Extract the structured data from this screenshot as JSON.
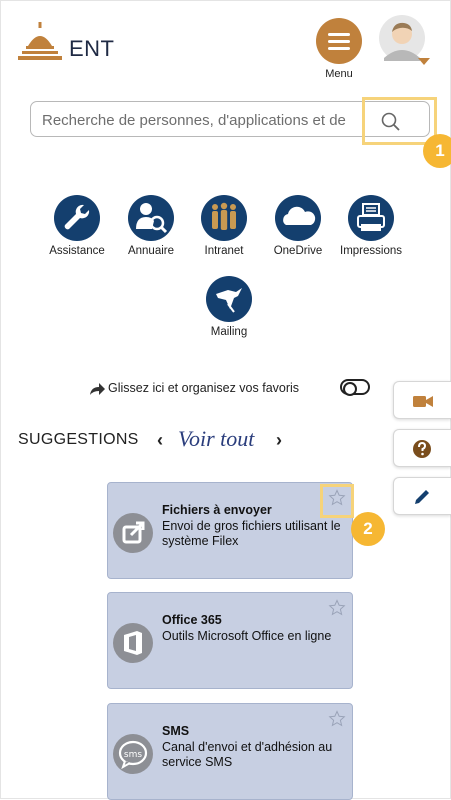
{
  "header": {
    "brand": "ENT",
    "menu_label": "Menu"
  },
  "search": {
    "placeholder": "Recherche de personnes, d'applications et de"
  },
  "apps": [
    {
      "label": "Assistance",
      "icon": "wrench-dsiun-icon"
    },
    {
      "label": "Annuaire",
      "icon": "person-search-icon"
    },
    {
      "label": "Intranet",
      "icon": "people-group-icon"
    },
    {
      "label": "OneDrive",
      "icon": "cloud-icon"
    },
    {
      "label": "Impressions",
      "icon": "printer-icon"
    },
    {
      "label": "Mailing",
      "icon": "bird-mail-icon"
    }
  ],
  "favorites": {
    "text": "Glissez ici et organisez vos favoris",
    "toggle_on": false
  },
  "suggestions": {
    "title": "SUGGESTIONS",
    "see_all": "Voir tout",
    "cards": [
      {
        "title": "Fichiers à envoyer",
        "description": "Envoi de gros fichiers utilisant le système Filex",
        "icon": "external-link-icon"
      },
      {
        "title": "Office 365",
        "description": "Outils Microsoft Office en ligne",
        "icon": "office-icon"
      },
      {
        "title": "SMS",
        "description": "Canal d'envoi et d'adhésion au service SMS",
        "icon": "sms-icon"
      }
    ]
  },
  "side_buttons": [
    "video-camera-icon",
    "help-icon",
    "pencil-icon"
  ],
  "annotations": [
    "1",
    "2"
  ],
  "colors": {
    "navy": "#143f6e",
    "accent": "#c0813c",
    "card_bg": "#c7cfe2",
    "highlight": "#f6d37a",
    "badge": "#f6b733"
  }
}
